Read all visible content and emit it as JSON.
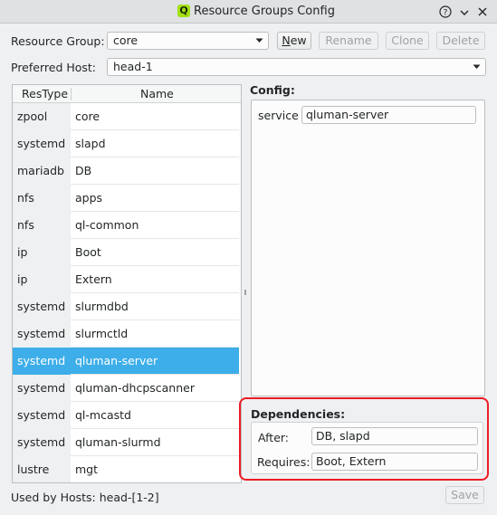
{
  "window": {
    "title": "Resource Groups Config",
    "app_icon_letter": "Q"
  },
  "top": {
    "resource_group_label": "Resource Group:",
    "resource_group_value": "core",
    "new_button": "New",
    "rename_button": "Rename",
    "clone_button": "Clone",
    "delete_button": "Delete",
    "preferred_host_label": "Preferred Host:",
    "preferred_host_value": "head-1"
  },
  "table": {
    "columns": [
      "ResType",
      "Name"
    ],
    "rows": [
      {
        "type": "zpool",
        "name": "core"
      },
      {
        "type": "systemd",
        "name": "slapd"
      },
      {
        "type": "mariadb",
        "name": "DB"
      },
      {
        "type": "nfs",
        "name": "apps"
      },
      {
        "type": "nfs",
        "name": "ql-common"
      },
      {
        "type": "ip",
        "name": "Boot"
      },
      {
        "type": "ip",
        "name": "Extern"
      },
      {
        "type": "systemd",
        "name": "slurmdbd"
      },
      {
        "type": "systemd",
        "name": "slurmctld"
      },
      {
        "type": "systemd",
        "name": "qluman-server"
      },
      {
        "type": "systemd",
        "name": "qluman-dhcpscanner"
      },
      {
        "type": "systemd",
        "name": "ql-mcastd"
      },
      {
        "type": "systemd",
        "name": "qluman-slurmd"
      },
      {
        "type": "lustre",
        "name": "mgt"
      }
    ],
    "selected_index": 9
  },
  "config": {
    "title": "Config:",
    "service_label": "service",
    "service_value": "qluman-server"
  },
  "dependencies": {
    "title": "Dependencies:",
    "after_label": "After:",
    "after_value": "DB, slapd",
    "requires_label": "Requires:",
    "requires_value": "Boot, Extern"
  },
  "footer": {
    "used_by": "Used by Hosts: head-[1-2]",
    "save_button": "Save"
  },
  "colors": {
    "selection": "#3daee9",
    "highlight_outline": "#ee1c24"
  }
}
